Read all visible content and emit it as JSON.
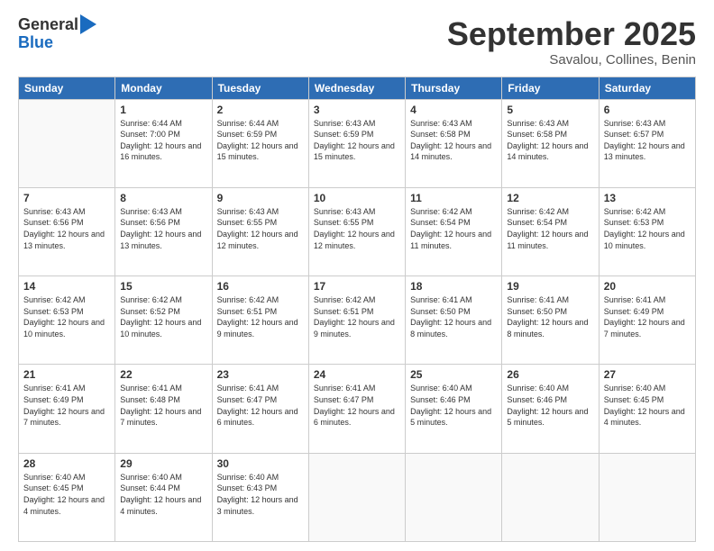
{
  "logo": {
    "general": "General",
    "blue": "Blue"
  },
  "header": {
    "month": "September 2025",
    "location": "Savalou, Collines, Benin"
  },
  "weekdays": [
    "Sunday",
    "Monday",
    "Tuesday",
    "Wednesday",
    "Thursday",
    "Friday",
    "Saturday"
  ],
  "weeks": [
    [
      {
        "day": "",
        "sunrise": "",
        "sunset": "",
        "daylight": ""
      },
      {
        "day": "1",
        "sunrise": "Sunrise: 6:44 AM",
        "sunset": "Sunset: 7:00 PM",
        "daylight": "Daylight: 12 hours and 16 minutes."
      },
      {
        "day": "2",
        "sunrise": "Sunrise: 6:44 AM",
        "sunset": "Sunset: 6:59 PM",
        "daylight": "Daylight: 12 hours and 15 minutes."
      },
      {
        "day": "3",
        "sunrise": "Sunrise: 6:43 AM",
        "sunset": "Sunset: 6:59 PM",
        "daylight": "Daylight: 12 hours and 15 minutes."
      },
      {
        "day": "4",
        "sunrise": "Sunrise: 6:43 AM",
        "sunset": "Sunset: 6:58 PM",
        "daylight": "Daylight: 12 hours and 14 minutes."
      },
      {
        "day": "5",
        "sunrise": "Sunrise: 6:43 AM",
        "sunset": "Sunset: 6:58 PM",
        "daylight": "Daylight: 12 hours and 14 minutes."
      },
      {
        "day": "6",
        "sunrise": "Sunrise: 6:43 AM",
        "sunset": "Sunset: 6:57 PM",
        "daylight": "Daylight: 12 hours and 13 minutes."
      }
    ],
    [
      {
        "day": "7",
        "sunrise": "Sunrise: 6:43 AM",
        "sunset": "Sunset: 6:56 PM",
        "daylight": "Daylight: 12 hours and 13 minutes."
      },
      {
        "day": "8",
        "sunrise": "Sunrise: 6:43 AM",
        "sunset": "Sunset: 6:56 PM",
        "daylight": "Daylight: 12 hours and 13 minutes."
      },
      {
        "day": "9",
        "sunrise": "Sunrise: 6:43 AM",
        "sunset": "Sunset: 6:55 PM",
        "daylight": "Daylight: 12 hours and 12 minutes."
      },
      {
        "day": "10",
        "sunrise": "Sunrise: 6:43 AM",
        "sunset": "Sunset: 6:55 PM",
        "daylight": "Daylight: 12 hours and 12 minutes."
      },
      {
        "day": "11",
        "sunrise": "Sunrise: 6:42 AM",
        "sunset": "Sunset: 6:54 PM",
        "daylight": "Daylight: 12 hours and 11 minutes."
      },
      {
        "day": "12",
        "sunrise": "Sunrise: 6:42 AM",
        "sunset": "Sunset: 6:54 PM",
        "daylight": "Daylight: 12 hours and 11 minutes."
      },
      {
        "day": "13",
        "sunrise": "Sunrise: 6:42 AM",
        "sunset": "Sunset: 6:53 PM",
        "daylight": "Daylight: 12 hours and 10 minutes."
      }
    ],
    [
      {
        "day": "14",
        "sunrise": "Sunrise: 6:42 AM",
        "sunset": "Sunset: 6:53 PM",
        "daylight": "Daylight: 12 hours and 10 minutes."
      },
      {
        "day": "15",
        "sunrise": "Sunrise: 6:42 AM",
        "sunset": "Sunset: 6:52 PM",
        "daylight": "Daylight: 12 hours and 10 minutes."
      },
      {
        "day": "16",
        "sunrise": "Sunrise: 6:42 AM",
        "sunset": "Sunset: 6:51 PM",
        "daylight": "Daylight: 12 hours and 9 minutes."
      },
      {
        "day": "17",
        "sunrise": "Sunrise: 6:42 AM",
        "sunset": "Sunset: 6:51 PM",
        "daylight": "Daylight: 12 hours and 9 minutes."
      },
      {
        "day": "18",
        "sunrise": "Sunrise: 6:41 AM",
        "sunset": "Sunset: 6:50 PM",
        "daylight": "Daylight: 12 hours and 8 minutes."
      },
      {
        "day": "19",
        "sunrise": "Sunrise: 6:41 AM",
        "sunset": "Sunset: 6:50 PM",
        "daylight": "Daylight: 12 hours and 8 minutes."
      },
      {
        "day": "20",
        "sunrise": "Sunrise: 6:41 AM",
        "sunset": "Sunset: 6:49 PM",
        "daylight": "Daylight: 12 hours and 7 minutes."
      }
    ],
    [
      {
        "day": "21",
        "sunrise": "Sunrise: 6:41 AM",
        "sunset": "Sunset: 6:49 PM",
        "daylight": "Daylight: 12 hours and 7 minutes."
      },
      {
        "day": "22",
        "sunrise": "Sunrise: 6:41 AM",
        "sunset": "Sunset: 6:48 PM",
        "daylight": "Daylight: 12 hours and 7 minutes."
      },
      {
        "day": "23",
        "sunrise": "Sunrise: 6:41 AM",
        "sunset": "Sunset: 6:47 PM",
        "daylight": "Daylight: 12 hours and 6 minutes."
      },
      {
        "day": "24",
        "sunrise": "Sunrise: 6:41 AM",
        "sunset": "Sunset: 6:47 PM",
        "daylight": "Daylight: 12 hours and 6 minutes."
      },
      {
        "day": "25",
        "sunrise": "Sunrise: 6:40 AM",
        "sunset": "Sunset: 6:46 PM",
        "daylight": "Daylight: 12 hours and 5 minutes."
      },
      {
        "day": "26",
        "sunrise": "Sunrise: 6:40 AM",
        "sunset": "Sunset: 6:46 PM",
        "daylight": "Daylight: 12 hours and 5 minutes."
      },
      {
        "day": "27",
        "sunrise": "Sunrise: 6:40 AM",
        "sunset": "Sunset: 6:45 PM",
        "daylight": "Daylight: 12 hours and 4 minutes."
      }
    ],
    [
      {
        "day": "28",
        "sunrise": "Sunrise: 6:40 AM",
        "sunset": "Sunset: 6:45 PM",
        "daylight": "Daylight: 12 hours and 4 minutes."
      },
      {
        "day": "29",
        "sunrise": "Sunrise: 6:40 AM",
        "sunset": "Sunset: 6:44 PM",
        "daylight": "Daylight: 12 hours and 4 minutes."
      },
      {
        "day": "30",
        "sunrise": "Sunrise: 6:40 AM",
        "sunset": "Sunset: 6:43 PM",
        "daylight": "Daylight: 12 hours and 3 minutes."
      },
      {
        "day": "",
        "sunrise": "",
        "sunset": "",
        "daylight": ""
      },
      {
        "day": "",
        "sunrise": "",
        "sunset": "",
        "daylight": ""
      },
      {
        "day": "",
        "sunrise": "",
        "sunset": "",
        "daylight": ""
      },
      {
        "day": "",
        "sunrise": "",
        "sunset": "",
        "daylight": ""
      }
    ]
  ]
}
